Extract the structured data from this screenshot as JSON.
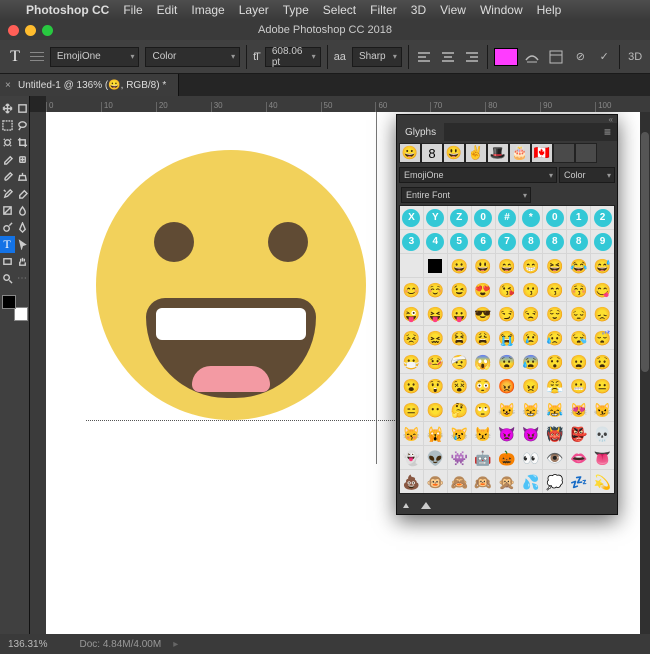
{
  "menu": {
    "apple": "",
    "app": "Photoshop CC",
    "items": [
      "File",
      "Edit",
      "Image",
      "Layer",
      "Type",
      "Select",
      "Filter",
      "3D",
      "View",
      "Window",
      "Help"
    ]
  },
  "titlebar": {
    "title": "Adobe Photoshop CC 2018"
  },
  "options": {
    "font": "EmojiOne",
    "style": "Color",
    "size_icon": "tT",
    "size": "608.06 pt",
    "aa_icon": "aa",
    "aa": "Sharp",
    "threeD": "3D",
    "cancel": "⊘",
    "commit": "✓",
    "color": "#ff3cff"
  },
  "doctab": {
    "label": "Untitled-1 @ 136% (😀, RGB/8) *",
    "close": "×"
  },
  "ruler_marks": [
    "0",
    "10",
    "20",
    "30",
    "40",
    "50",
    "60",
    "70",
    "80",
    "90",
    "100"
  ],
  "status": {
    "zoom": "136.31%",
    "doc": "Doc: 4.84M/4.00M",
    "arrow": "▸"
  },
  "glyphs": {
    "title": "Glyphs",
    "recent": [
      "😀",
      "8",
      "😃",
      "✌️",
      "🎩",
      "🎂",
      "🇨🇦"
    ],
    "font": "EmojiOne",
    "style": "Color",
    "filter": "Entire Font",
    "row1": [
      "X",
      "Y",
      "Z",
      "0",
      "#",
      "*",
      "0",
      "1",
      "2"
    ],
    "row2": [
      "3",
      "4",
      "5",
      "6",
      "7",
      "8",
      "8",
      "8",
      "9"
    ],
    "grid": [
      "",
      "⬛",
      "😀",
      "😃",
      "😄",
      "😁",
      "😆",
      "😂",
      "😅",
      "😊",
      "☺️",
      "😉",
      "😍",
      "😘",
      "😗",
      "😙",
      "😚",
      "😋",
      "😜",
      "😝",
      "😛",
      "😎",
      "😏",
      "😒",
      "😌",
      "😔",
      "😞",
      "😣",
      "😖",
      "😫",
      "😩",
      "😭",
      "😢",
      "😥",
      "😪",
      "😴",
      "😷",
      "🤒",
      "🤕",
      "😱",
      "😨",
      "😰",
      "😯",
      "😦",
      "😧",
      "😮",
      "😲",
      "😵",
      "😳",
      "😡",
      "😠",
      "😤",
      "😬",
      "😐",
      "😑",
      "😶",
      "🤔",
      "🙄",
      "😺",
      "😸",
      "😹",
      "😻",
      "😼",
      "😽",
      "🙀",
      "😿",
      "😾",
      "👿",
      "😈",
      "👹",
      "👺",
      "💀",
      "👻",
      "👽",
      "👾",
      "🤖",
      "🎃",
      "👀",
      "👁️",
      "👄",
      "👅",
      "💩",
      "🐵",
      "🙈",
      "🙉",
      "🙊",
      "💦",
      "💭",
      "💤",
      "💫"
    ]
  }
}
